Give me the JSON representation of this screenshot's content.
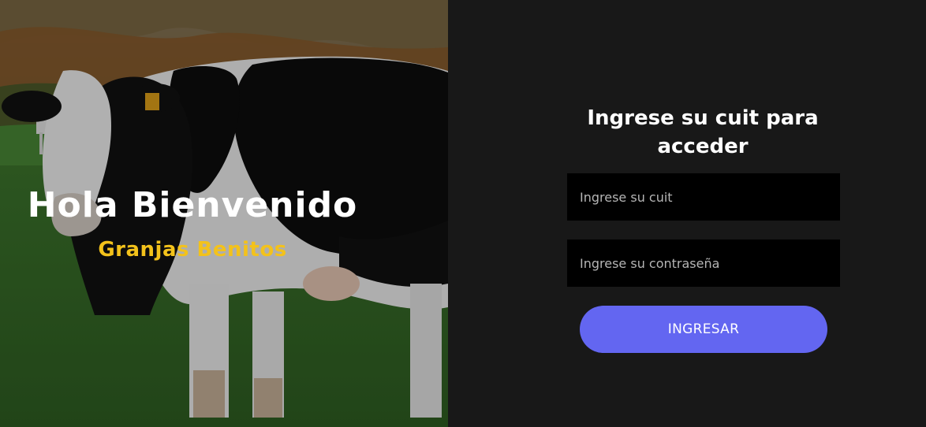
{
  "hero": {
    "title": "Hola Bienvenido",
    "subtitle": "Granjas Benitos",
    "subtitle_color": "#f3c21b"
  },
  "login": {
    "heading": "Ingrese su cuit para acceder",
    "cuit_placeholder": "Ingrese su cuit",
    "password_placeholder": "Ingrese su contraseña",
    "submit_label": "INGRESAR",
    "accent_color": "#6366f1"
  }
}
